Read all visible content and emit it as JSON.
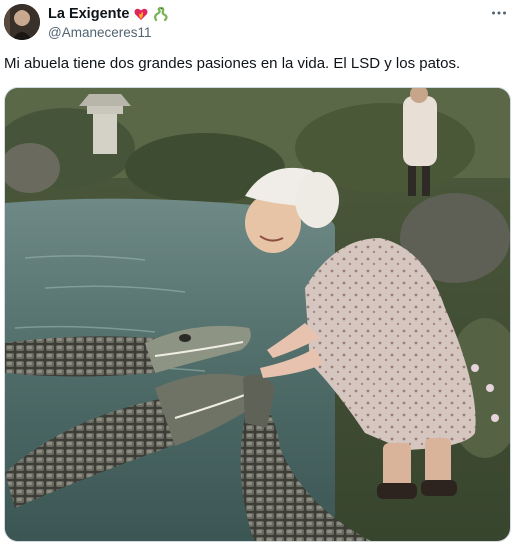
{
  "tweet": {
    "display_name": "La Exigente",
    "handle": "@Amaneceres11",
    "text": "Mi abuela tiene dos grandes pasiones en la vida. El LSD y los patos.",
    "name_emojis": [
      "heart-on-fire-emoji",
      "snake-emoji"
    ],
    "more_icon": "more-horizontal-icon"
  },
  "media": {
    "alt_subject": "photo"
  },
  "colors": {
    "text_primary": "#0f1419",
    "text_secondary": "#536471",
    "border": "#cfd9de"
  }
}
